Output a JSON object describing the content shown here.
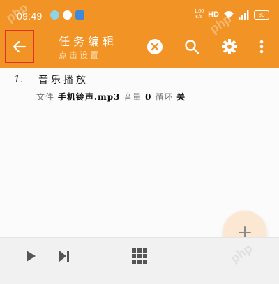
{
  "status_bar": {
    "time": "09:49",
    "net_speed_value": "1.00",
    "net_speed_unit": "K/s",
    "network_label": "HD",
    "battery_level": "80"
  },
  "toolbar": {
    "title": "任务编辑",
    "subtitle": "点击设置"
  },
  "task": {
    "index": "1.",
    "name": "音乐播放",
    "detail_file_label": "文件",
    "detail_file_value": "手机铃声.mp3",
    "detail_mode_label": "音量",
    "detail_mode_value": "0",
    "detail_loop_label": "循环",
    "detail_loop_value": "关"
  },
  "watermark": {
    "text": "php"
  },
  "colors": {
    "toolbar": "#f19325",
    "fab": "#fbe7d2",
    "highlight": "#e0312a"
  }
}
